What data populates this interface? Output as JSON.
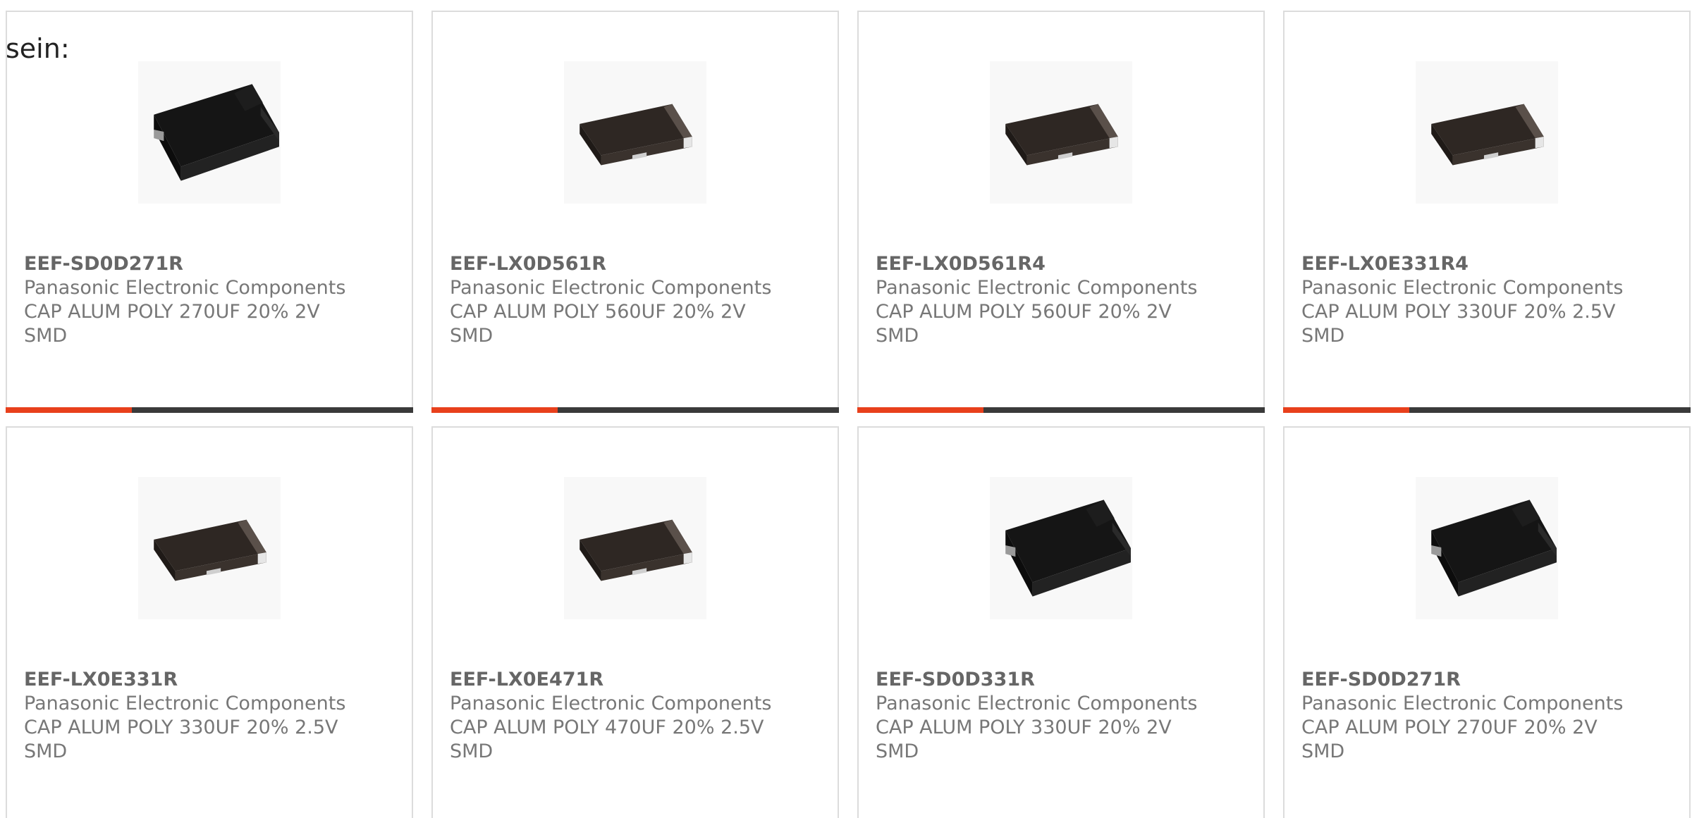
{
  "heading": "sein:",
  "colors": {
    "accent": "#e8401c",
    "track": "#3a3a3a",
    "text": "#777777"
  },
  "products": [
    {
      "part": "EEF-SD0D271R",
      "manufacturer": "Panasonic Electronic Components",
      "desc": "CAP ALUM POLY 270UF 20% 2V",
      "type": "SMD",
      "progress": 0.31,
      "image": "large-capacitor"
    },
    {
      "part": "EEF-LX0D561R",
      "manufacturer": "Panasonic Electronic Components",
      "desc": "CAP ALUM POLY 560UF 20% 2V",
      "type": "SMD",
      "progress": 0.31,
      "image": "small-capacitor"
    },
    {
      "part": "EEF-LX0D561R4",
      "manufacturer": "Panasonic Electronic Components",
      "desc": "CAP ALUM POLY 560UF 20% 2V",
      "type": "SMD",
      "progress": 0.31,
      "image": "small-capacitor"
    },
    {
      "part": "EEF-LX0E331R4",
      "manufacturer": "Panasonic Electronic Components",
      "desc": "CAP ALUM POLY 330UF 20% 2.5V",
      "type": "SMD",
      "progress": 0.31,
      "image": "small-capacitor"
    },
    {
      "part": "EEF-LX0E331R",
      "manufacturer": "Panasonic Electronic Components",
      "desc": "CAP ALUM POLY 330UF 20% 2.5V",
      "type": "SMD",
      "image": "small-capacitor"
    },
    {
      "part": "EEF-LX0E471R",
      "manufacturer": "Panasonic Electronic Components",
      "desc": "CAP ALUM POLY 470UF 20% 2.5V",
      "type": "SMD",
      "image": "small-capacitor"
    },
    {
      "part": "EEF-SD0D331R",
      "manufacturer": "Panasonic Electronic Components",
      "desc": "CAP ALUM POLY 330UF 20% 2V",
      "type": "SMD",
      "image": "large-capacitor"
    },
    {
      "part": "EEF-SD0D271R",
      "manufacturer": "Panasonic Electronic Components",
      "desc": "CAP ALUM POLY 270UF 20% 2V",
      "type": "SMD",
      "image": "large-capacitor"
    }
  ]
}
